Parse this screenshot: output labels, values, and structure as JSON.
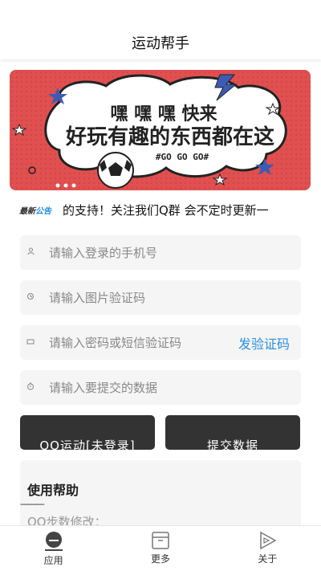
{
  "header": {
    "title": "运动帮手"
  },
  "banner": {
    "line1": "嘿 嘿 嘿 快来",
    "line2": "好玩有趣的东西都在这",
    "tag": "#GO GO GO#",
    "colors": {
      "background": "#e05050",
      "cloud": "#ffffff",
      "text": "#222222"
    }
  },
  "notice": {
    "logo_prefix": "最新",
    "logo_suffix": "公告",
    "text": "的支持！关注我们Q群 会不定时更新一"
  },
  "form": {
    "phone_placeholder": "请输入登录的手机号",
    "captcha_placeholder": "请输入图片验证码",
    "password_placeholder": "请输入密码或短信验证码",
    "send_code_label": "发验证码",
    "data_placeholder": "请输入要提交的数据"
  },
  "buttons": {
    "qq_status_label": "QQ运动[未登录]",
    "submit_label": "提交数据"
  },
  "help": {
    "title": "使用帮助",
    "divider": "----------",
    "first_item": "QQ步数修改："
  },
  "tabbar": {
    "items": [
      {
        "label": "应用",
        "icon": "app-icon"
      },
      {
        "label": "更多",
        "icon": "more-icon"
      },
      {
        "label": "关于",
        "icon": "about-icon"
      }
    ]
  },
  "accent_color": "#2a8fe0",
  "button_color": "#333333"
}
